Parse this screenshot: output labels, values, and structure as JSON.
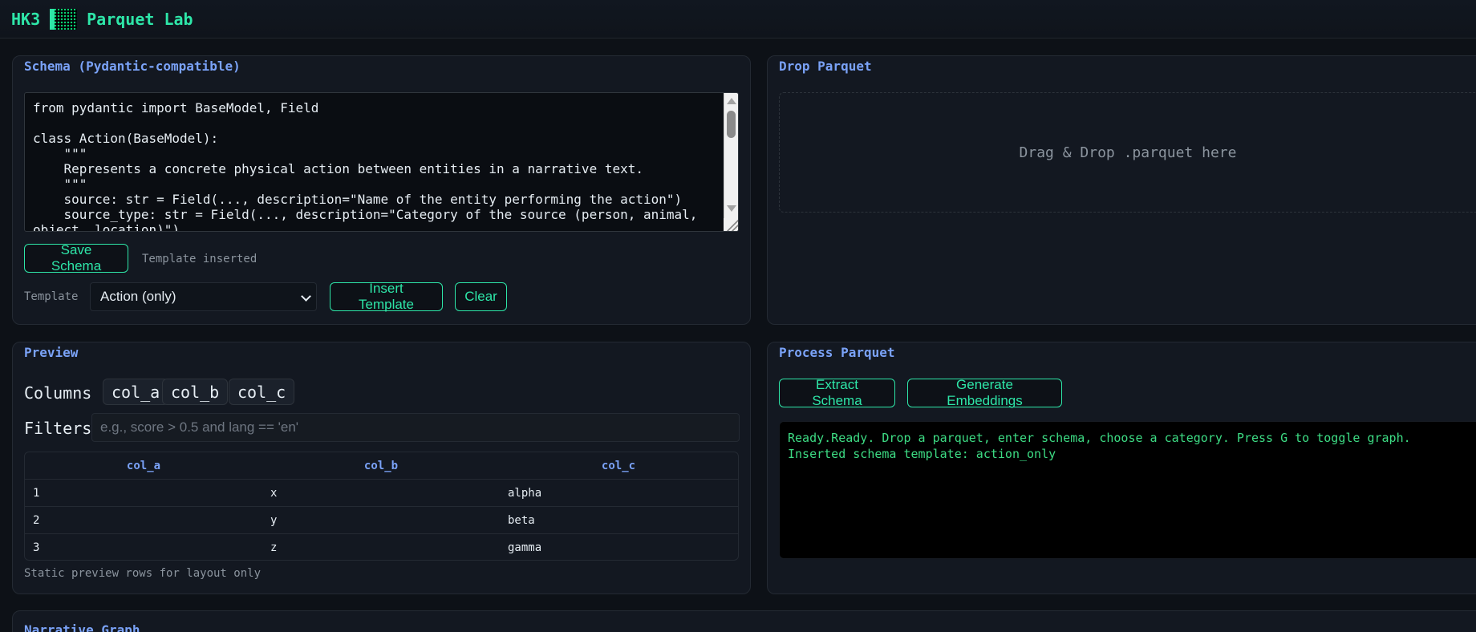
{
  "header": {
    "brand_prefix": "HK3",
    "brand_name": "Parquet Lab"
  },
  "schema_panel": {
    "title": "Schema (Pydantic-compatible)",
    "code": "from pydantic import BaseModel, Field\n\nclass Action(BaseModel):\n    \"\"\"\n    Represents a concrete physical action between entities in a narrative text.\n    \"\"\"\n    source: str = Field(..., description=\"Name of the entity performing the action\")\n    source_type: str = Field(..., description=\"Category of the source (person, animal,\nobject, location)\")",
    "save_button": "Save Schema",
    "status": "Template inserted",
    "template_label": "Template",
    "template_selected": "Action (only)",
    "insert_button": "Insert Template",
    "clear_button": "Clear"
  },
  "drop_panel": {
    "title": "Drop Parquet",
    "dropzone_text": "Drag & Drop .parquet here"
  },
  "preview_panel": {
    "title": "Preview",
    "columns_label": "Columns",
    "columns": [
      "col_a",
      "col_b",
      "col_c"
    ],
    "filters_label": "Filters",
    "filters_placeholder": "e.g., score > 0.5 and lang == 'en'",
    "table": {
      "headers": [
        "col_a",
        "col_b",
        "col_c"
      ],
      "rows": [
        [
          "1",
          "x",
          "alpha"
        ],
        [
          "2",
          "y",
          "beta"
        ],
        [
          "3",
          "z",
          "gamma"
        ]
      ]
    },
    "note": "Static preview rows for layout only"
  },
  "process_panel": {
    "title": "Process Parquet",
    "extract_button": "Extract Schema",
    "embed_button": "Generate Embeddings",
    "log_lines": [
      "Ready.Ready. Drop a parquet, enter schema, choose a category. Press G to toggle graph.",
      "Inserted schema template: action_only"
    ]
  },
  "narrative_panel": {
    "title": "Narrative Graph"
  },
  "colors": {
    "accent": "#2ee6a8",
    "title_blue": "#7aa2f7",
    "log_green": "#3ddc84",
    "background": "#0d1117"
  }
}
